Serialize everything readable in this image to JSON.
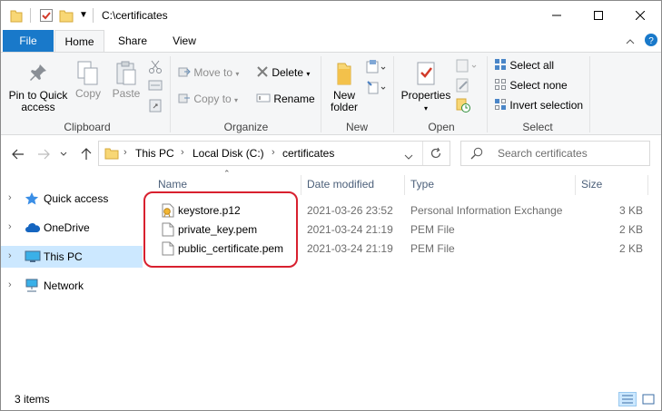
{
  "window": {
    "title": "C:\\certificates",
    "controls": {
      "minimize": "minimize-icon",
      "maximize": "maximize-icon",
      "close": "close-icon"
    }
  },
  "ribbon_tabs": [
    "File",
    "Home",
    "Share",
    "View"
  ],
  "ribbon": {
    "clipboard": {
      "label": "Clipboard",
      "pin_label_1": "Pin to Quick",
      "pin_label_2": "access",
      "copy": "Copy",
      "paste": "Paste"
    },
    "organize": {
      "label": "Organize",
      "move_to": "Move to",
      "copy_to": "Copy to",
      "delete": "Delete",
      "rename": "Rename"
    },
    "new": {
      "label": "New",
      "new_folder_1": "New",
      "new_folder_2": "folder"
    },
    "open": {
      "label": "Open",
      "properties": "Properties"
    },
    "select": {
      "label": "Select",
      "select_all": "Select all",
      "select_none": "Select none",
      "invert_selection": "Invert selection"
    }
  },
  "address": {
    "crumbs": [
      "This PC",
      "Local Disk (C:)",
      "certificates"
    ],
    "search_placeholder": "Search certificates"
  },
  "nav_pane": [
    {
      "label": "Quick access",
      "icon": "star-icon",
      "selected": false
    },
    {
      "label": "OneDrive",
      "icon": "cloud-icon",
      "selected": false
    },
    {
      "label": "This PC",
      "icon": "computer-icon",
      "selected": true
    },
    {
      "label": "Network",
      "icon": "network-icon",
      "selected": false
    }
  ],
  "columns": [
    "Name",
    "Date modified",
    "Type",
    "Size"
  ],
  "files": [
    {
      "name": "keystore.p12",
      "date": "2021-03-26 23:52",
      "type": "Personal Information Exchange",
      "size": "3 KB",
      "icon": "certificate-file-icon"
    },
    {
      "name": "private_key.pem",
      "date": "2021-03-24 21:19",
      "type": "PEM File",
      "size": "2 KB",
      "icon": "file-icon"
    },
    {
      "name": "public_certificate.pem",
      "date": "2021-03-24 21:19",
      "type": "PEM File",
      "size": "2 KB",
      "icon": "file-icon"
    }
  ],
  "status": {
    "item_count": "3 items"
  },
  "colors": {
    "accent": "#1979ca",
    "selection": "#cce8ff",
    "highlight_outline": "#d8202f"
  }
}
